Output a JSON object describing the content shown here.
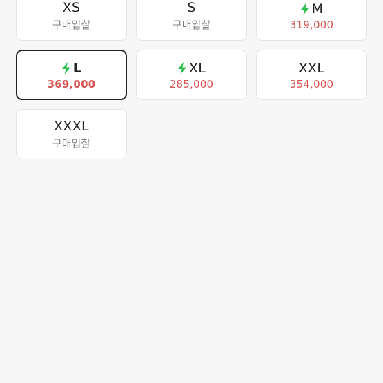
{
  "sizes": [
    {
      "label": "XS",
      "sub": "구매입찰",
      "sub_type": "bid",
      "fast": false,
      "selected": false
    },
    {
      "label": "S",
      "sub": "구매입찰",
      "sub_type": "bid",
      "fast": false,
      "selected": false
    },
    {
      "label": "M",
      "sub": "319,000",
      "sub_type": "price",
      "fast": true,
      "selected": false
    },
    {
      "label": "L",
      "sub": "369,000",
      "sub_type": "price",
      "fast": true,
      "selected": true
    },
    {
      "label": "XL",
      "sub": "285,000",
      "sub_type": "price",
      "fast": true,
      "selected": false
    },
    {
      "label": "XXL",
      "sub": "354,000",
      "sub_type": "price",
      "fast": false,
      "selected": false
    },
    {
      "label": "XXXL",
      "sub": "구매입찰",
      "sub_type": "bid",
      "fast": false,
      "selected": false
    }
  ],
  "colors": {
    "price": "#d9534f",
    "bolt": "#2dbe4f",
    "selected_border": "#222222",
    "background": "#f7f7f7"
  },
  "icons": {
    "fast_delivery": "lightning-bolt-icon"
  }
}
